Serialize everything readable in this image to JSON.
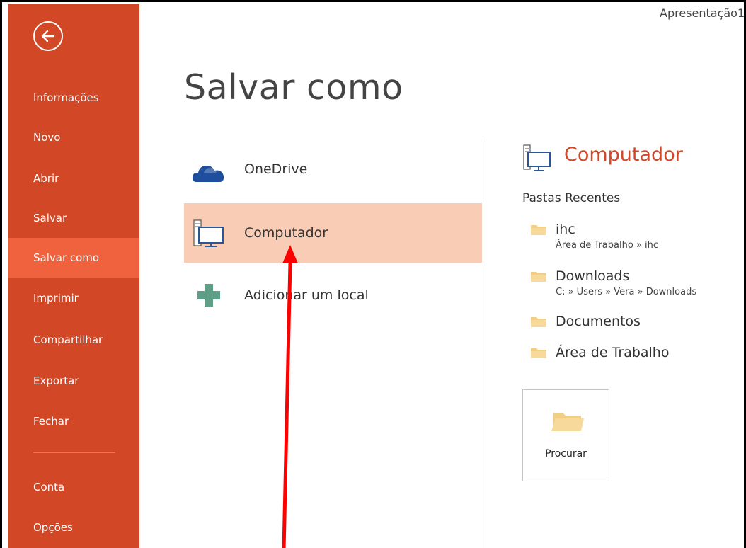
{
  "window": {
    "title": "Apresentação1 -"
  },
  "sidebar": {
    "items": [
      {
        "label": "Informações"
      },
      {
        "label": "Novo"
      },
      {
        "label": "Abrir"
      },
      {
        "label": "Salvar"
      },
      {
        "label": "Salvar como"
      },
      {
        "label": "Imprimir"
      },
      {
        "label": "Compartilhar"
      },
      {
        "label": "Exportar"
      },
      {
        "label": "Fechar"
      },
      {
        "label": "Conta"
      },
      {
        "label": "Opções"
      }
    ],
    "active_item": "Salvar como"
  },
  "page": {
    "title": "Salvar como"
  },
  "places": [
    {
      "label": "OneDrive",
      "icon": "onedrive-cloud-icon"
    },
    {
      "label": "Computador",
      "icon": "computer-icon",
      "selected": true
    },
    {
      "label": "Adicionar um local",
      "icon": "add-plus-icon"
    }
  ],
  "detail": {
    "heading": "Computador",
    "heading_icon": "computer-icon",
    "recent_label": "Pastas Recentes",
    "folders": [
      {
        "name": "ihc",
        "path": "Área de Trabalho » ihc"
      },
      {
        "name": "Downloads",
        "path": "C: » Users » Vera » Downloads"
      },
      {
        "name": "Documentos",
        "path": ""
      },
      {
        "name": "Área de Trabalho",
        "path": ""
      }
    ],
    "browse_label": "Procurar"
  },
  "colors": {
    "accent": "#d24726",
    "active_nav": "#f0623e",
    "selected_place": "#f8ccb5",
    "folder": "#f2ce84",
    "annotation_arrow": "#ff0000"
  }
}
